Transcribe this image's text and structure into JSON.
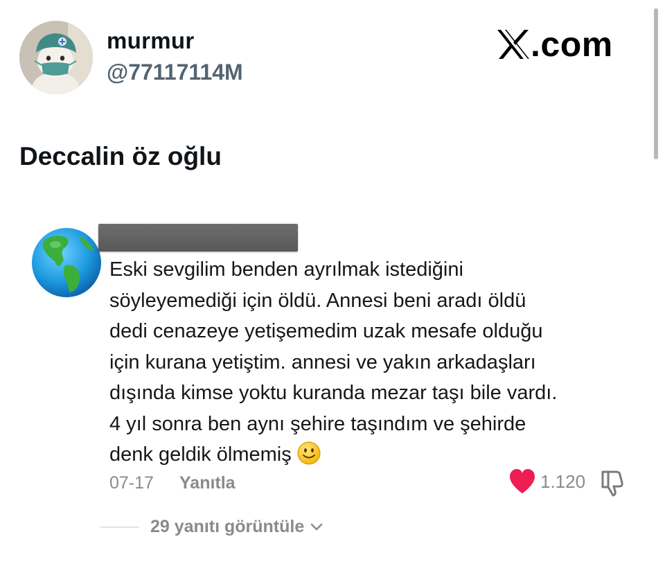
{
  "author": {
    "display_name": "murmur",
    "handle": "@77117114M",
    "avatar_icon": "cat-in-surgical-mask-avatar"
  },
  "brand": {
    "logo_icon": "x-logo-icon",
    "suffix": ".com"
  },
  "tweet": {
    "text": "Deccalin öz oğlu"
  },
  "embedded_comment": {
    "avatar_icon": "globe-emoji-icon",
    "username_redacted": true,
    "lines": [
      "Eski sevgilim benden ayrılmak istediğini",
      "söyleyemediği için öldü. Annesi beni aradı öldü",
      "dedi cenazeye yetişemedim uzak mesafe olduğu",
      "için kurana yetiştim. annesi ve yakın arkadaşları",
      "dışında kimse yoktu kuranda mezar taşı bile vardı.",
      "4 yıl sonra ben aynı şehire taşındım ve şehirde",
      "denk geldik ölmemiş"
    ],
    "trailing_emoji": "slightly-smiling-face-icon",
    "date": "07-17",
    "reply_label": "Yanıtla",
    "like_count": "1.120",
    "like_color": "#ee1d52",
    "view_replies_label": "29 yanıtı görüntüle"
  }
}
